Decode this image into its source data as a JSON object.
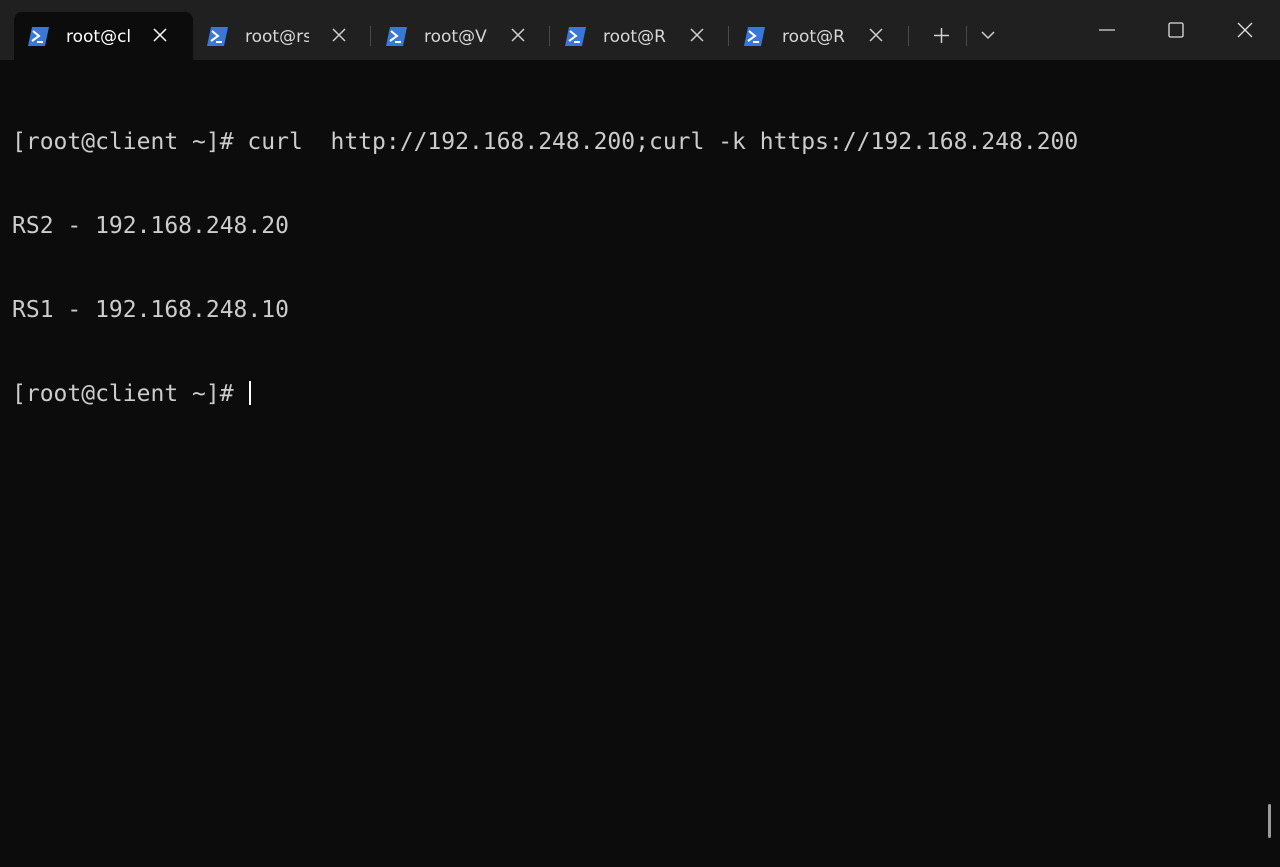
{
  "tabs": [
    {
      "title": "root@client",
      "active": true
    },
    {
      "title": "root@rs",
      "active": false
    },
    {
      "title": "root@VS",
      "active": false
    },
    {
      "title": "root@RS",
      "active": false
    },
    {
      "title": "root@RS",
      "active": false
    }
  ],
  "terminal": {
    "lines": [
      "[root@client ~]# curl  http://192.168.248.200;curl -k https://192.168.248.200",
      "RS2 - 192.168.248.20",
      "RS1 - 192.168.248.10"
    ],
    "prompt": "[root@client ~]# "
  },
  "colors": {
    "background": "#0c0c0c",
    "titlebar": "#202020",
    "text": "#cccccc",
    "icon_blue": "#3a78d8"
  },
  "icons": {
    "tab": "powershell-icon",
    "close": "close-icon",
    "new_tab": "plus-icon",
    "dropdown": "chevron-down-icon",
    "minimize": "minimize-icon",
    "maximize": "maximize-icon",
    "window_close": "window-close-icon"
  }
}
